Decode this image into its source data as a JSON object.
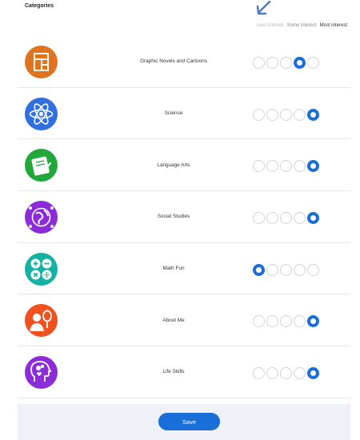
{
  "header": {
    "title": "Categories",
    "legend": {
      "less": "Less interest",
      "some": "Some interest",
      "most": "Most interest"
    }
  },
  "rating_scale": 5,
  "accent_color": "#1a6ed8",
  "categories": [
    {
      "label": "Graphic Novels and Cartoons",
      "icon": "graphic-novel-icon",
      "color": "#e0741e",
      "selected": 4
    },
    {
      "label": "Science",
      "icon": "atom-icon",
      "color": "#2f6fe0",
      "selected": 5
    },
    {
      "label": "Language Arts",
      "icon": "scroll-icon",
      "color": "#22a83a",
      "selected": 5
    },
    {
      "label": "Social Studies",
      "icon": "globe-icon",
      "color": "#8c2cd8",
      "selected": 5
    },
    {
      "label": "Math Fun",
      "icon": "math-symbols-icon",
      "color": "#13b2a2",
      "selected": 1
    },
    {
      "label": "About Me",
      "icon": "person-mirror-icon",
      "color": "#f0511e",
      "selected": 5
    },
    {
      "label": "Life Skills",
      "icon": "head-gears-icon",
      "color": "#8c2cd8",
      "selected": 5
    }
  ],
  "footer": {
    "save_label": "Save"
  }
}
